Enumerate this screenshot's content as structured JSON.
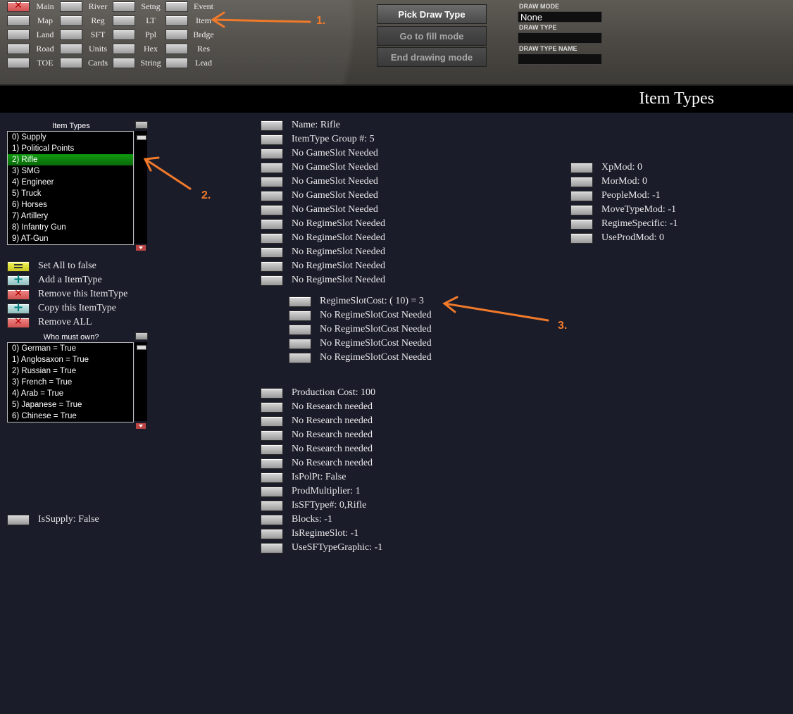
{
  "nav": [
    {
      "label": "Main",
      "red": true
    },
    {
      "label": "River"
    },
    {
      "label": "Setng"
    },
    {
      "label": "Event"
    },
    {
      "label": "Map"
    },
    {
      "label": "Reg"
    },
    {
      "label": "LT"
    },
    {
      "label": "Item"
    },
    {
      "label": "Land"
    },
    {
      "label": "SFT"
    },
    {
      "label": "Ppl"
    },
    {
      "label": "Brdge"
    },
    {
      "label": "Road"
    },
    {
      "label": "Units"
    },
    {
      "label": "Hex"
    },
    {
      "label": "Res"
    },
    {
      "label": "TOE"
    },
    {
      "label": "Cards"
    },
    {
      "label": "String"
    },
    {
      "label": "Lead"
    }
  ],
  "draw_buttons": {
    "pick": "Pick Draw Type",
    "fill": "Go to fill mode",
    "end": "End drawing mode"
  },
  "draw_info": {
    "mode_label": "DRAW MODE",
    "mode_value": "None",
    "type_label": "DRAW TYPE",
    "type_value": "",
    "name_label": "DRAW TYPE NAME",
    "name_value": ""
  },
  "page_title": "Item Types",
  "item_types_list": {
    "label": "Item Types",
    "items": [
      "0) Supply",
      "1) Political Points",
      "2) Rifle",
      "3) SMG",
      "4) Engineer",
      "5) Truck",
      "6) Horses",
      "7) Artillery",
      "8) Infantry Gun",
      "9) AT-Gun"
    ],
    "selected_index": 2
  },
  "actions": {
    "set_false": "Set All to false",
    "add": "Add a ItemType",
    "remove": "Remove this ItemType",
    "copy": "Copy this ItemType",
    "remove_all": "Remove ALL"
  },
  "who_list": {
    "label": "Who must own?",
    "items": [
      "0) German = True",
      "1) Anglosaxon = True",
      "2) Russian = True",
      "3) French = True",
      "4) Arab = True",
      "5) Japanese = True",
      "6) Chinese = True"
    ]
  },
  "is_supply": "IsSupply: False",
  "props_a": [
    "Name: Rifle",
    "ItemType Group #:  5",
    "No GameSlot Needed",
    "No GameSlot Needed",
    "No GameSlot Needed",
    "No GameSlot Needed",
    "No GameSlot Needed",
    "No RegimeSlot Needed",
    "No RegimeSlot Needed",
    "No RegimeSlot Needed",
    "No RegimeSlot Needed",
    "No RegimeSlot Needed"
  ],
  "props_cost": [
    "RegimeSlotCost: ( 10) =  3",
    "No RegimeSlotCost Needed",
    "No RegimeSlotCost Needed",
    "No RegimeSlotCost Needed",
    "No RegimeSlotCost Needed"
  ],
  "props_b": [
    "Production Cost:  100",
    "No Research needed",
    "No Research needed",
    "No Research needed",
    "No Research needed",
    "No Research needed",
    "IsPolPt: False",
    "ProdMultiplier:  1",
    "IsSFType#:  0,Rifle",
    "Blocks: -1",
    "IsRegimeSlot: -1",
    "UseSFTypeGraphic: -1"
  ],
  "props_right": [
    "XpMod:  0",
    "MorMod:  0",
    "PeopleMod: -1",
    "MoveTypeMod: -1",
    "RegimeSpecific: -1",
    "UseProdMod:  0"
  ],
  "annotations": {
    "one": "1.",
    "two": "2.",
    "three": "3.",
    "color": "#f07a2a"
  }
}
